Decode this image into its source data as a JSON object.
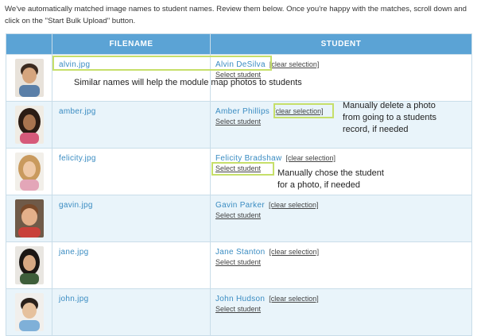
{
  "intro_text": "We've automatically matched image names to student names. Review them below. Once you're happy with the matches, scroll down and click on the \"Start Bulk Upload\" button.",
  "table": {
    "headers": {
      "filename": "FILENAME",
      "student": "STUDENT"
    },
    "rows": [
      {
        "filename": "alvin.jpg",
        "student": "Alvin DeSilva",
        "clear": "[clear selection]",
        "select": "Select student"
      },
      {
        "filename": "amber.jpg",
        "student": "Amber Phillips",
        "clear": "[clear selection]",
        "select": "Select student"
      },
      {
        "filename": "felicity.jpg",
        "student": "Felicity Bradshaw",
        "clear": "[clear selection]",
        "select": "Select student"
      },
      {
        "filename": "gavin.jpg",
        "student": "Gavin Parker",
        "clear": "[clear selection]",
        "select": "Select student"
      },
      {
        "filename": "jane.jpg",
        "student": "Jane Stanton",
        "clear": "[clear selection]",
        "select": "Select student"
      },
      {
        "filename": "john.jpg",
        "student": "John Hudson",
        "clear": "[clear selection]",
        "select": "Select student"
      }
    ]
  },
  "annotations": {
    "similar_names": "Similar names will help the module map photos to students",
    "delete_photo_1": "Manually delete a photo",
    "delete_photo_2": "from going to a students",
    "delete_photo_3": "record, if needed",
    "choose_student_1": "Manually chose the student",
    "choose_student_2": "for a photo, if needed"
  },
  "colors": {
    "header": "#5ba3d5",
    "link": "#3a8cc2",
    "highlight": "#c6df6a",
    "alt_row": "#e9f4fa"
  }
}
